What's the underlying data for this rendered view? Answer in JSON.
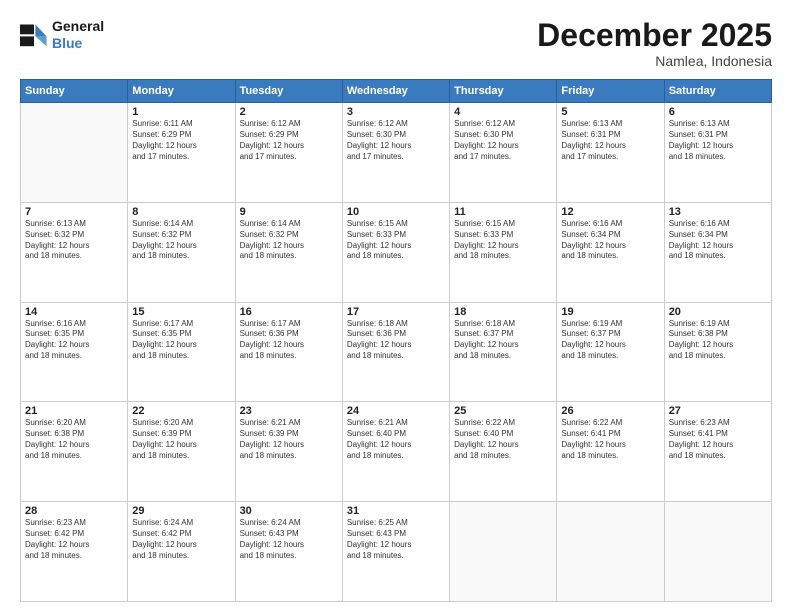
{
  "logo": {
    "line1": "General",
    "line2": "Blue"
  },
  "title": "December 2025",
  "subtitle": "Namlea, Indonesia",
  "days_header": [
    "Sunday",
    "Monday",
    "Tuesday",
    "Wednesday",
    "Thursday",
    "Friday",
    "Saturday"
  ],
  "weeks": [
    [
      {
        "day": "",
        "info": ""
      },
      {
        "day": "1",
        "info": "Sunrise: 6:11 AM\nSunset: 6:29 PM\nDaylight: 12 hours\nand 17 minutes."
      },
      {
        "day": "2",
        "info": "Sunrise: 6:12 AM\nSunset: 6:29 PM\nDaylight: 12 hours\nand 17 minutes."
      },
      {
        "day": "3",
        "info": "Sunrise: 6:12 AM\nSunset: 6:30 PM\nDaylight: 12 hours\nand 17 minutes."
      },
      {
        "day": "4",
        "info": "Sunrise: 6:12 AM\nSunset: 6:30 PM\nDaylight: 12 hours\nand 17 minutes."
      },
      {
        "day": "5",
        "info": "Sunrise: 6:13 AM\nSunset: 6:31 PM\nDaylight: 12 hours\nand 17 minutes."
      },
      {
        "day": "6",
        "info": "Sunrise: 6:13 AM\nSunset: 6:31 PM\nDaylight: 12 hours\nand 18 minutes."
      }
    ],
    [
      {
        "day": "7",
        "info": "Sunrise: 6:13 AM\nSunset: 6:32 PM\nDaylight: 12 hours\nand 18 minutes."
      },
      {
        "day": "8",
        "info": "Sunrise: 6:14 AM\nSunset: 6:32 PM\nDaylight: 12 hours\nand 18 minutes."
      },
      {
        "day": "9",
        "info": "Sunrise: 6:14 AM\nSunset: 6:32 PM\nDaylight: 12 hours\nand 18 minutes."
      },
      {
        "day": "10",
        "info": "Sunrise: 6:15 AM\nSunset: 6:33 PM\nDaylight: 12 hours\nand 18 minutes."
      },
      {
        "day": "11",
        "info": "Sunrise: 6:15 AM\nSunset: 6:33 PM\nDaylight: 12 hours\nand 18 minutes."
      },
      {
        "day": "12",
        "info": "Sunrise: 6:16 AM\nSunset: 6:34 PM\nDaylight: 12 hours\nand 18 minutes."
      },
      {
        "day": "13",
        "info": "Sunrise: 6:16 AM\nSunset: 6:34 PM\nDaylight: 12 hours\nand 18 minutes."
      }
    ],
    [
      {
        "day": "14",
        "info": "Sunrise: 6:16 AM\nSunset: 6:35 PM\nDaylight: 12 hours\nand 18 minutes."
      },
      {
        "day": "15",
        "info": "Sunrise: 6:17 AM\nSunset: 6:35 PM\nDaylight: 12 hours\nand 18 minutes."
      },
      {
        "day": "16",
        "info": "Sunrise: 6:17 AM\nSunset: 6:36 PM\nDaylight: 12 hours\nand 18 minutes."
      },
      {
        "day": "17",
        "info": "Sunrise: 6:18 AM\nSunset: 6:36 PM\nDaylight: 12 hours\nand 18 minutes."
      },
      {
        "day": "18",
        "info": "Sunrise: 6:18 AM\nSunset: 6:37 PM\nDaylight: 12 hours\nand 18 minutes."
      },
      {
        "day": "19",
        "info": "Sunrise: 6:19 AM\nSunset: 6:37 PM\nDaylight: 12 hours\nand 18 minutes."
      },
      {
        "day": "20",
        "info": "Sunrise: 6:19 AM\nSunset: 6:38 PM\nDaylight: 12 hours\nand 18 minutes."
      }
    ],
    [
      {
        "day": "21",
        "info": "Sunrise: 6:20 AM\nSunset: 6:38 PM\nDaylight: 12 hours\nand 18 minutes."
      },
      {
        "day": "22",
        "info": "Sunrise: 6:20 AM\nSunset: 6:39 PM\nDaylight: 12 hours\nand 18 minutes."
      },
      {
        "day": "23",
        "info": "Sunrise: 6:21 AM\nSunset: 6:39 PM\nDaylight: 12 hours\nand 18 minutes."
      },
      {
        "day": "24",
        "info": "Sunrise: 6:21 AM\nSunset: 6:40 PM\nDaylight: 12 hours\nand 18 minutes."
      },
      {
        "day": "25",
        "info": "Sunrise: 6:22 AM\nSunset: 6:40 PM\nDaylight: 12 hours\nand 18 minutes."
      },
      {
        "day": "26",
        "info": "Sunrise: 6:22 AM\nSunset: 6:41 PM\nDaylight: 12 hours\nand 18 minutes."
      },
      {
        "day": "27",
        "info": "Sunrise: 6:23 AM\nSunset: 6:41 PM\nDaylight: 12 hours\nand 18 minutes."
      }
    ],
    [
      {
        "day": "28",
        "info": "Sunrise: 6:23 AM\nSunset: 6:42 PM\nDaylight: 12 hours\nand 18 minutes."
      },
      {
        "day": "29",
        "info": "Sunrise: 6:24 AM\nSunset: 6:42 PM\nDaylight: 12 hours\nand 18 minutes."
      },
      {
        "day": "30",
        "info": "Sunrise: 6:24 AM\nSunset: 6:43 PM\nDaylight: 12 hours\nand 18 minutes."
      },
      {
        "day": "31",
        "info": "Sunrise: 6:25 AM\nSunset: 6:43 PM\nDaylight: 12 hours\nand 18 minutes."
      },
      {
        "day": "",
        "info": ""
      },
      {
        "day": "",
        "info": ""
      },
      {
        "day": "",
        "info": ""
      }
    ]
  ]
}
